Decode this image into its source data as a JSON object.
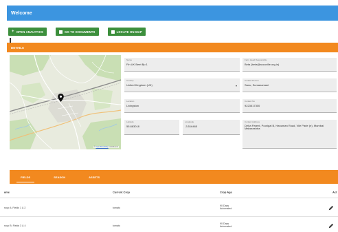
{
  "header": {
    "title": "Welcome"
  },
  "actions": {
    "analytics_label": "OPEN ANALYTICS",
    "documents_label": "GO TO DOCUMENTS",
    "map_label": "LOCATE ON MAP"
  },
  "details": {
    "title": "DETAILS"
  },
  "map": {
    "credit_prefix": "© ",
    "credit_link": "OpenStreetMap",
    "credit_suffix": " contributors"
  },
  "fields": {
    "name": {
      "label": "Name",
      "value": "Fin UK Beet Bp 1"
    },
    "country": {
      "label": "Country",
      "value": "United Kingdom (UK)"
    },
    "location": {
      "label": "Location",
      "value": "Livingston"
    },
    "latitude": {
      "label": "Latitude",
      "value": "55.883018"
    },
    "longitude": {
      "label": "Longitude",
      "value": "-3.516465"
    },
    "contact_email": {
      "label": "Farm Head Responsible",
      "value": "Beta (beta@accuville.org.in)"
    },
    "contact_person": {
      "label": "Contact Person",
      "value": "Sanu, Sumanamani"
    },
    "contact_no": {
      "label": "Contact No",
      "value": "9223517300"
    },
    "address": {
      "label": "Contact Address",
      "value": "Deha Parent, Poorigal B, Hanuman Road, Vile Parle (e), Mumbai Maharashtra"
    }
  },
  "tabs": [
    {
      "label": "FIELDS"
    },
    {
      "label": "SEASON"
    },
    {
      "label": "ASSETS"
    }
  ],
  "table": {
    "columns": [
      "ame",
      "Current Crop",
      "Crop Age",
      "Act"
    ],
    "rows": [
      {
        "name": "roup A: Fields 1 & 2",
        "crop": "tomato",
        "age_line1": "90 Days",
        "age_line2": "Automated"
      },
      {
        "name": "roup B: Fields 3 & 4",
        "crop": "tomato",
        "age_line1": "90 Days",
        "age_line2": "Automated"
      }
    ]
  },
  "colors": {
    "header": "#3c95e0",
    "button": "#3c8f3c",
    "accent": "#f2891f"
  },
  "icons": {
    "marker": "map-pin-icon",
    "edit": "pencil-icon"
  }
}
